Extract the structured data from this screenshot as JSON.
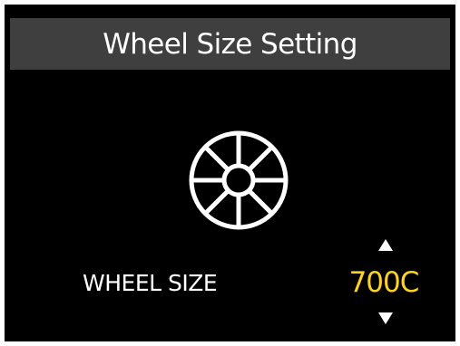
{
  "screen": {
    "title": "Wheel Size Setting"
  },
  "setting": {
    "label": "WHEEL SIZE",
    "value": "700C",
    "value_color": "#ffd21f"
  },
  "icons": {
    "wheel": "bicycle-wheel-icon",
    "increase": "arrow-up-icon",
    "decrease": "arrow-down-icon"
  },
  "colors": {
    "background": "#000000",
    "header_bar": "#3f3f3f",
    "text": "#ffffff",
    "accent": "#ffd21f"
  }
}
